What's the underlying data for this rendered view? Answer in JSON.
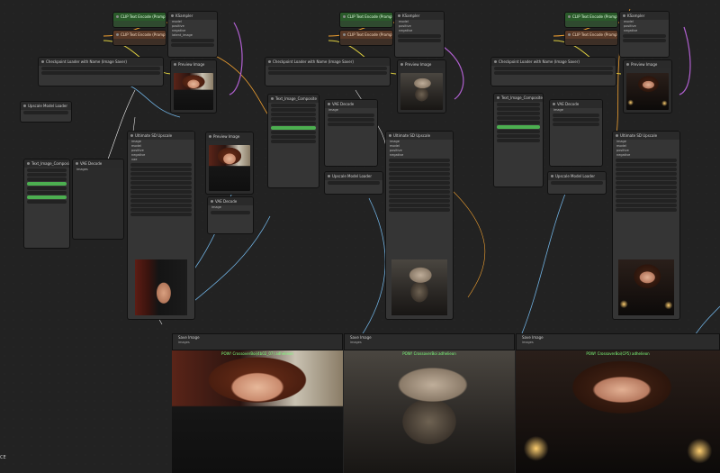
{
  "app": {
    "corner_label": "CE"
  },
  "colors": {
    "canvas": "#222222",
    "green_node": "#2a5a2a",
    "brown_node": "#5a3a28",
    "wire_orange": "#f0a030",
    "wire_blue": "#6fb0e0",
    "wire_purple": "#b060d0",
    "wire_yellow": "#e0d040"
  },
  "groups": [
    {
      "id": "g1",
      "clip_positive": "CLIP Text Encode (Prompt)",
      "clip_negative": "CLIP Text Encode (Prompt)",
      "ksampler": "KSampler",
      "checkpoint": "Checkpoint Loader with Name (Image Saver)",
      "text_composite": "Text_Image_Composite",
      "upscale_model": "Upscale Model Loader",
      "ultimate_upscale": "Ultimate SD Upscale",
      "preview": "Preview Image",
      "vae_decode": "VAE Decode",
      "save": "Save Image",
      "caption": "POW! CrossoverBoi(4b02_07) adhelieon",
      "image_tag": "img-portrait"
    },
    {
      "id": "g2",
      "clip_positive": "CLIP Text Encode (Prompt)",
      "clip_negative": "CLIP Text Encode (Prompt)",
      "ksampler": "KSampler",
      "checkpoint": "Checkpoint Loader with Name (Image Saver)",
      "text_composite": "Text_Image_Composite",
      "upscale_model": "Upscale Model Loader",
      "ultimate_upscale": "Ultimate SD Upscale",
      "preview": "Preview Image",
      "vae_decode": "VAE Decode",
      "save": "Save Image",
      "caption": "POW! CrossoverBoi adhelieon",
      "image_tag": "img-alien"
    },
    {
      "id": "g3",
      "clip_positive": "CLIP Text Encode (Prompt)",
      "clip_negative": "CLIP Text Encode (Prompt)",
      "ksampler": "KSampler",
      "checkpoint": "Checkpoint Loader with Name (Image Saver)",
      "text_composite": "Text_Image_Composite",
      "upscale_model": "Upscale Model Loader",
      "ultimate_upscale": "Ultimate SD Upscale",
      "preview": "Preview Image",
      "vae_decode": "VAE Decode",
      "save": "Save Image",
      "caption": "POW! CrossoverBoi(CP5) adhelieon",
      "image_tag": "img-candle"
    }
  ],
  "ports": {
    "model": "model",
    "positive": "positive",
    "negative": "negative",
    "latent": "latent_image",
    "seed": "seed",
    "steps": "steps",
    "cfg": "cfg",
    "sampler": "sampler_name",
    "image": "image",
    "upscale_model": "upscale_model",
    "vae": "vae",
    "images": "images",
    "filename": "filename_prefix",
    "samples": "samples",
    "IMAGE": "IMAGE",
    "LATENT": "LATENT"
  }
}
